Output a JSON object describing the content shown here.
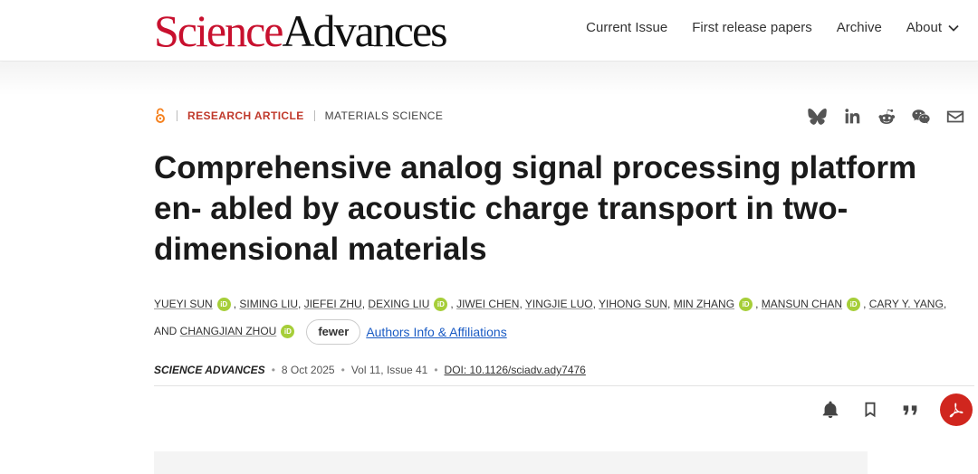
{
  "header": {
    "brand_science": "Science",
    "brand_advances": "Advances",
    "nav": [
      "Current Issue",
      "First release papers",
      "Archive",
      "About"
    ]
  },
  "article": {
    "type": "RESEARCH ARTICLE",
    "subject": "MATERIALS SCIENCE",
    "title": "Comprehensive analog signal processing platform en- abled by acoustic charge transport in two-dimensional materials",
    "authors": [
      {
        "name": "YUEYI SUN",
        "orcid": true,
        "sep": ", "
      },
      {
        "name": "SIMING LIU",
        "orcid": false,
        "sep": ", "
      },
      {
        "name": "JIEFEI ZHU",
        "orcid": false,
        "sep": ", "
      },
      {
        "name": "DEXING LIU",
        "orcid": true,
        "sep": ", "
      },
      {
        "name": "JIWEI CHEN",
        "orcid": false,
        "sep": ", "
      },
      {
        "name": "YINGJIE LUO",
        "orcid": false,
        "sep": ", "
      },
      {
        "name": "YIHONG SUN",
        "orcid": false,
        "sep": ", "
      },
      {
        "name": "MIN ZHANG",
        "orcid": true,
        "sep": ", "
      },
      {
        "name": "MANSUN CHAN",
        "orcid": true,
        "sep": ", "
      },
      {
        "name": "CARY Y. YANG",
        "orcid": false,
        "sep": ", AND "
      },
      {
        "name": "CHANGJIAN ZHOU",
        "orcid": true,
        "sep": ""
      }
    ],
    "fewer_label": "fewer",
    "affiliations_label": "Authors Info & Affiliations",
    "journal": "SCIENCE ADVANCES",
    "date": "8 Oct 2025",
    "volume": "Vol 11, Issue 41",
    "doi": "DOI: 10.1126/sciadv.ady7476",
    "orcid_glyph": "iD"
  },
  "icons": {
    "share": [
      "bluesky-icon",
      "linkedin-icon",
      "reddit-icon",
      "wechat-icon",
      "email-icon"
    ],
    "actions": [
      "bell-icon",
      "bookmark-icon",
      "quote-icon",
      "pdf-icon"
    ]
  },
  "colors": {
    "brand_red": "#c8102e",
    "article_type": "#c0392b",
    "orcid": "#a6ce39",
    "link": "#1a5bc4",
    "pdf": "#d0261e"
  }
}
